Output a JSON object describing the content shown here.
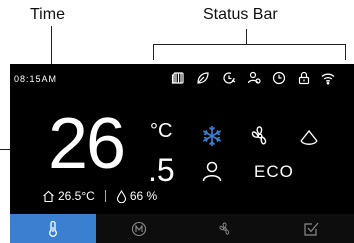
{
  "callouts": {
    "time_label": "Time",
    "status_bar_label": "Status Bar"
  },
  "status": {
    "time": "08:15AM",
    "icons": [
      "filter-icon",
      "sleep-leaf-icon",
      "timer-icon",
      "user-mode-icon",
      "clock-icon",
      "child-lock-icon",
      "wifi-icon"
    ]
  },
  "temperature": {
    "integer": "26",
    "decimal": ".5",
    "unit": "°C",
    "indoor": "26.5°C",
    "humidity": "66 %"
  },
  "modes": {
    "icons": [
      "snowflake-icon",
      "fan-icon",
      "swing-icon",
      "person-icon"
    ],
    "eco_label": "ECO",
    "active_color": "#3a7fd0"
  },
  "nav": {
    "items": [
      "thermometer-icon",
      "mode-m-icon",
      "fan-icon",
      "check-box-icon"
    ],
    "active_index": 0,
    "active_color": "#3a7fd0"
  }
}
